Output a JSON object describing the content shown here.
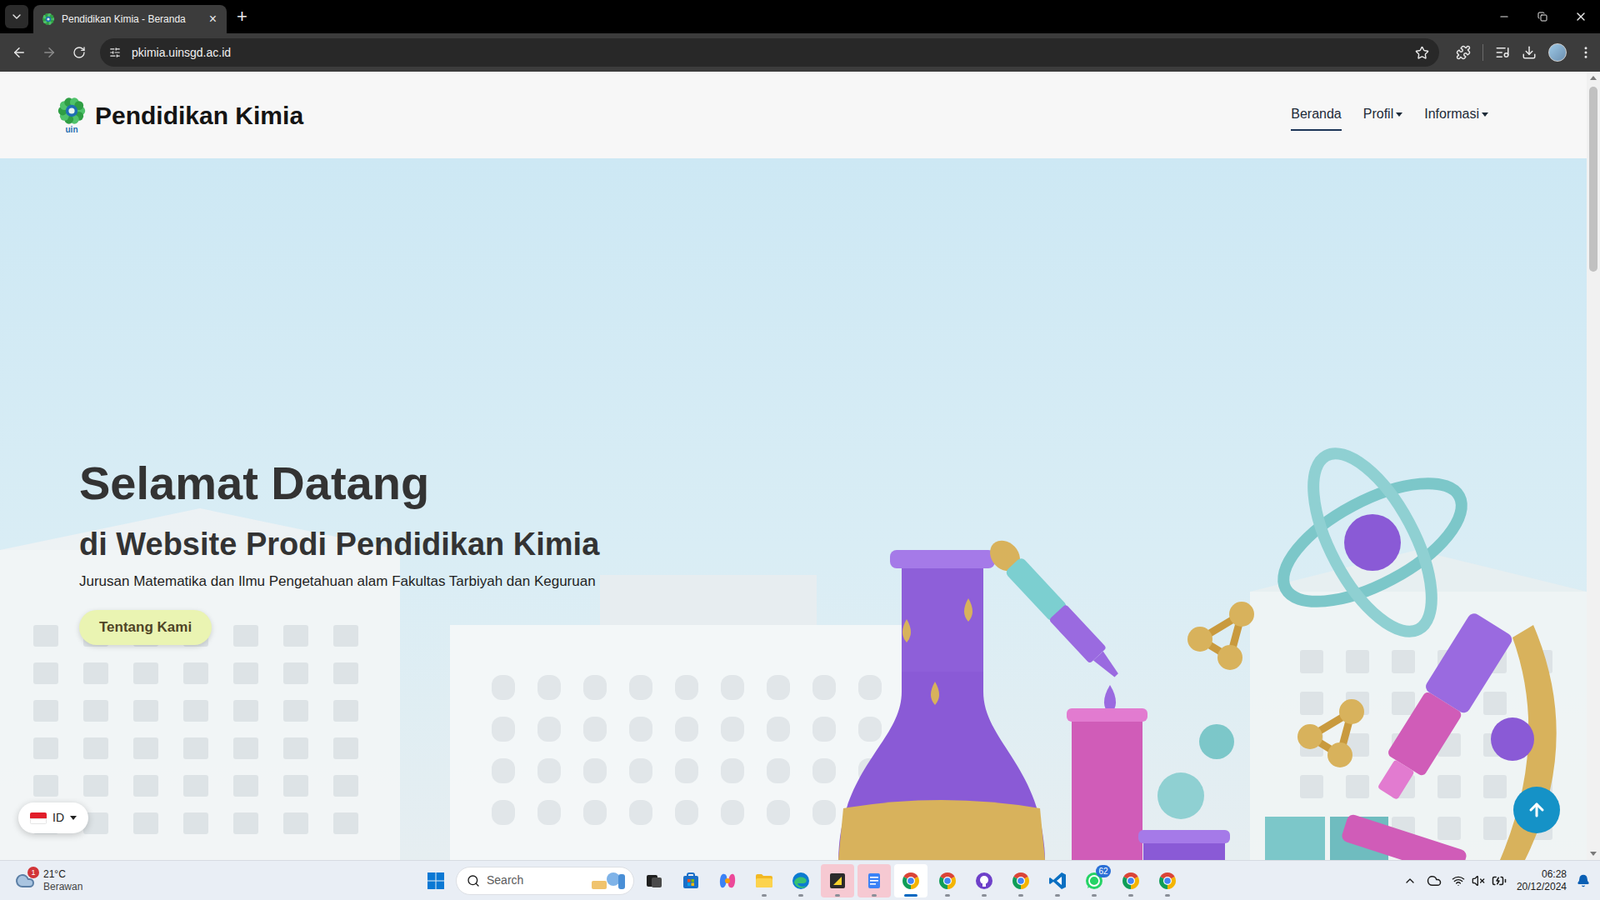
{
  "browser": {
    "tabs": [
      {
        "title": "Pendidikan Kimia - Beranda",
        "selected": true,
        "close": "×"
      }
    ],
    "new_tab": "+",
    "url": "pkimia.uinsgd.ac.id",
    "bookmarked": false
  },
  "site": {
    "logo_mark": "uin",
    "brand": "Pendidikan Kimia",
    "nav": [
      {
        "label": "Beranda",
        "selected": true,
        "dropdown": false
      },
      {
        "label": "Profil",
        "selected": false,
        "dropdown": true
      },
      {
        "label": "Informasi",
        "selected": false,
        "dropdown": true
      }
    ]
  },
  "hero": {
    "title": "Selamat Datang",
    "subtitle": "di Website Prodi Pendidikan Kimia",
    "description": "Jurusan Matematika dan Ilmu Pengetahuan alam Fakultas Tarbiyah dan Keguruan",
    "button": "Tentang Kami"
  },
  "language": {
    "code": "ID"
  },
  "taskbar": {
    "weather": {
      "temp": "21°C",
      "condition": "Berawan",
      "badge": "1"
    },
    "search_placeholder": "Search",
    "apps": [
      {
        "kind": "task-view",
        "state": "idle"
      },
      {
        "kind": "store",
        "state": "idle"
      },
      {
        "kind": "copilot",
        "state": "idle"
      },
      {
        "kind": "explorer",
        "state": "running"
      },
      {
        "kind": "edge",
        "state": "running"
      },
      {
        "kind": "sticky",
        "state": "attention"
      },
      {
        "kind": "notepad",
        "state": "attention"
      },
      {
        "kind": "chrome",
        "state": "active"
      },
      {
        "kind": "chrome",
        "state": "running"
      },
      {
        "kind": "github",
        "state": "running"
      },
      {
        "kind": "chrome",
        "state": "running"
      },
      {
        "kind": "vscode",
        "state": "running"
      },
      {
        "kind": "whatsapp",
        "state": "running",
        "badge": "62"
      },
      {
        "kind": "chrome",
        "state": "running"
      },
      {
        "kind": "chrome",
        "state": "running"
      }
    ],
    "time": "06:28",
    "date": "20/12/2024"
  }
}
